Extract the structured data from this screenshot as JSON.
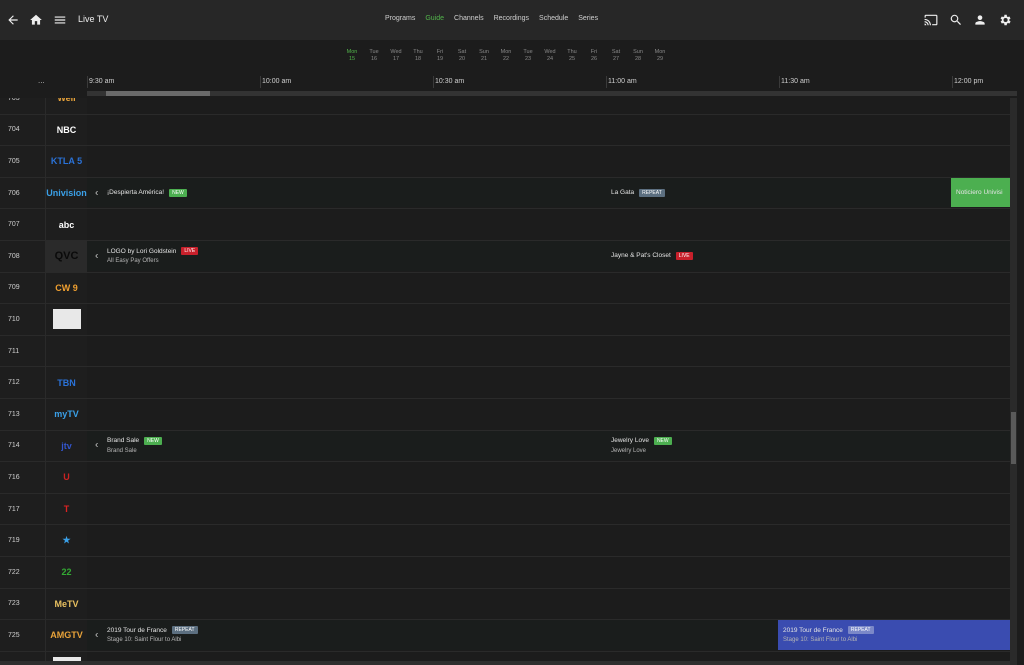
{
  "header": {
    "title": "Live TV",
    "nav": [
      {
        "label": "Programs",
        "active": false
      },
      {
        "label": "Guide",
        "active": true
      },
      {
        "label": "Channels",
        "active": false
      },
      {
        "label": "Recordings",
        "active": false
      },
      {
        "label": "Schedule",
        "active": false
      },
      {
        "label": "Series",
        "active": false
      }
    ],
    "icons": [
      "back-arrow-icon",
      "home-icon",
      "menu-icon",
      "cast-icon",
      "search-icon",
      "user-icon",
      "settings-icon"
    ]
  },
  "dates": [
    {
      "day": "Mon",
      "num": "15",
      "active": true
    },
    {
      "day": "Tue",
      "num": "16",
      "active": false
    },
    {
      "day": "Wed",
      "num": "17",
      "active": false
    },
    {
      "day": "Thu",
      "num": "18",
      "active": false
    },
    {
      "day": "Fri",
      "num": "19",
      "active": false
    },
    {
      "day": "Sat",
      "num": "20",
      "active": false
    },
    {
      "day": "Sun",
      "num": "21",
      "active": false
    },
    {
      "day": "Mon",
      "num": "22",
      "active": false
    },
    {
      "day": "Tue",
      "num": "23",
      "active": false
    },
    {
      "day": "Wed",
      "num": "24",
      "active": false
    },
    {
      "day": "Thu",
      "num": "25",
      "active": false
    },
    {
      "day": "Fri",
      "num": "26",
      "active": false
    },
    {
      "day": "Sat",
      "num": "27",
      "active": false
    },
    {
      "day": "Sun",
      "num": "28",
      "active": false
    },
    {
      "day": "Mon",
      "num": "29",
      "active": false
    }
  ],
  "timebar": {
    "more": "...",
    "times": [
      "9:30 am",
      "10:00 am",
      "10:30 am",
      "11:00 am",
      "11:30 am",
      "12:00 pm"
    ]
  },
  "channels": [
    {
      "num": "703",
      "logo": "Well",
      "logo_color": "#e8a33a"
    },
    {
      "num": "704",
      "logo": "NBC",
      "logo_color": "#ffffff"
    },
    {
      "num": "705",
      "logo": "KTLA 5",
      "logo_color": "#2a72d8"
    },
    {
      "num": "706",
      "logo": "Univision",
      "logo_color": "#3aa0e8"
    },
    {
      "num": "707",
      "logo": "abc",
      "logo_color": "#ffffff"
    },
    {
      "num": "708",
      "logo": "QVC",
      "logo_color": "#111111"
    },
    {
      "num": "709",
      "logo": "CW 9",
      "logo_color": "#f0a030"
    },
    {
      "num": "710",
      "logo": "",
      "logo_color": "#dddddd"
    },
    {
      "num": "711",
      "logo": "",
      "logo_color": "#552222"
    },
    {
      "num": "712",
      "logo": "TBN",
      "logo_color": "#2a72d8"
    },
    {
      "num": "713",
      "logo": "myTV",
      "logo_color": "#3aa0e8"
    },
    {
      "num": "714",
      "logo": "jtv",
      "logo_color": "#3355cc"
    },
    {
      "num": "716",
      "logo": "U",
      "logo_color": "#cc2222"
    },
    {
      "num": "717",
      "logo": "T",
      "logo_color": "#dd2222"
    },
    {
      "num": "719",
      "logo": "★",
      "logo_color": "#3aa0e8"
    },
    {
      "num": "722",
      "logo": "22",
      "logo_color": "#33aa33"
    },
    {
      "num": "723",
      "logo": "MeTV",
      "logo_color": "#e8c060"
    },
    {
      "num": "725",
      "logo": "AMGTV",
      "logo_color": "#e8a33a"
    },
    {
      "num": "726",
      "logo": "",
      "logo_color": "#dddddd"
    }
  ],
  "programs": [
    {
      "row": 3,
      "start": 87,
      "end": 606,
      "title": "¡Despierta América!",
      "badge": "NEW",
      "sub": "",
      "chev": true,
      "bg": ""
    },
    {
      "row": 3,
      "start": 606,
      "end": 951,
      "title": "La Gata",
      "badge": "REPEAT",
      "sub": "",
      "chev": false,
      "bg": ""
    },
    {
      "row": 3,
      "start": 951,
      "end": 1010,
      "title": "Noticiero Univisi",
      "badge": "",
      "sub": "",
      "chev": false,
      "bg": "#4caf50"
    },
    {
      "row": 5,
      "start": 87,
      "end": 606,
      "title": "LOGO by Lori Goldstein",
      "badge": "LIVE",
      "sub": "All Easy Pay Offers",
      "chev": true,
      "bg": ""
    },
    {
      "row": 5,
      "start": 606,
      "end": 1010,
      "title": "Jayne & Pat's Closet",
      "badge": "LIVE",
      "sub": "",
      "chev": false,
      "bg": ""
    },
    {
      "row": 11,
      "start": 87,
      "end": 606,
      "title": "Brand Sale",
      "badge": "NEW",
      "sub": "Brand Sale",
      "chev": true,
      "bg": ""
    },
    {
      "row": 11,
      "start": 606,
      "end": 1010,
      "title": "Jewelry Love",
      "badge": "NEW",
      "sub": "Jewelry Love",
      "chev": false,
      "bg": ""
    },
    {
      "row": 17,
      "start": 87,
      "end": 778,
      "title": "2019 Tour de France",
      "badge": "REPEAT",
      "sub": "Stage 10: Saint Flour to Albi",
      "chev": true,
      "bg": ""
    },
    {
      "row": 17,
      "start": 778,
      "end": 1010,
      "title": "2019 Tour de France",
      "badge": "REPEAT",
      "sub": "Stage 10: Saint Flour to Albi",
      "chev": false,
      "bg": "#3a4cb0"
    }
  ]
}
